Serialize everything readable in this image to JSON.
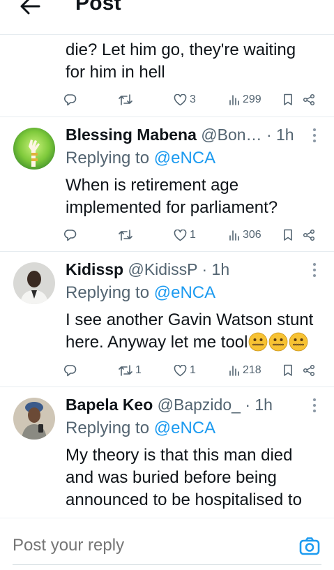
{
  "header": {
    "title": "Post",
    "back_icon": "arrow-left-icon"
  },
  "tweets": [
    {
      "text_lines": [
        "die? Let him go, they're waiting",
        "for him in hell"
      ],
      "actions": {
        "reply": "",
        "retweet": "",
        "likes": "3",
        "views": "299"
      }
    },
    {
      "name": "Blessing Mabena",
      "handle": "@Bon…",
      "time": "· 1h",
      "replying_prefix": "Replying to",
      "replying_handle": "@eNCA",
      "text_lines": [
        "When is retirement age",
        "implemented for parliament?"
      ],
      "actions": {
        "reply": "",
        "retweet": "",
        "likes": "1",
        "views": "306"
      }
    },
    {
      "name": "Kidissp",
      "handle": "@KidissP",
      "time": "· 1h",
      "replying_prefix": "Replying to",
      "replying_handle": "@eNCA",
      "text_lines": [
        "I see another Gavin Watson stunt",
        "here. Anyway let me tool"
      ],
      "emojis": [
        "zipper-mouth-face",
        "zipper-mouth-face",
        "zipper-mouth-face"
      ],
      "actions": {
        "reply": "",
        "retweet": "1",
        "likes": "1",
        "views": "218"
      }
    },
    {
      "name": "Bapela Keo",
      "handle": "@Bapzido_",
      "time": "· 1h",
      "replying_prefix": "Replying to",
      "replying_handle": "@eNCA",
      "text_lines": [
        "My theory is that this man died",
        "and was buried before being",
        "announced to be hospitalised to"
      ]
    }
  ],
  "reply_bar": {
    "placeholder": "Post your reply",
    "camera_icon": "camera-icon"
  },
  "colors": {
    "accent": "#1d9bf0",
    "secondary_text": "#536471",
    "divider": "#e6ecf0"
  }
}
